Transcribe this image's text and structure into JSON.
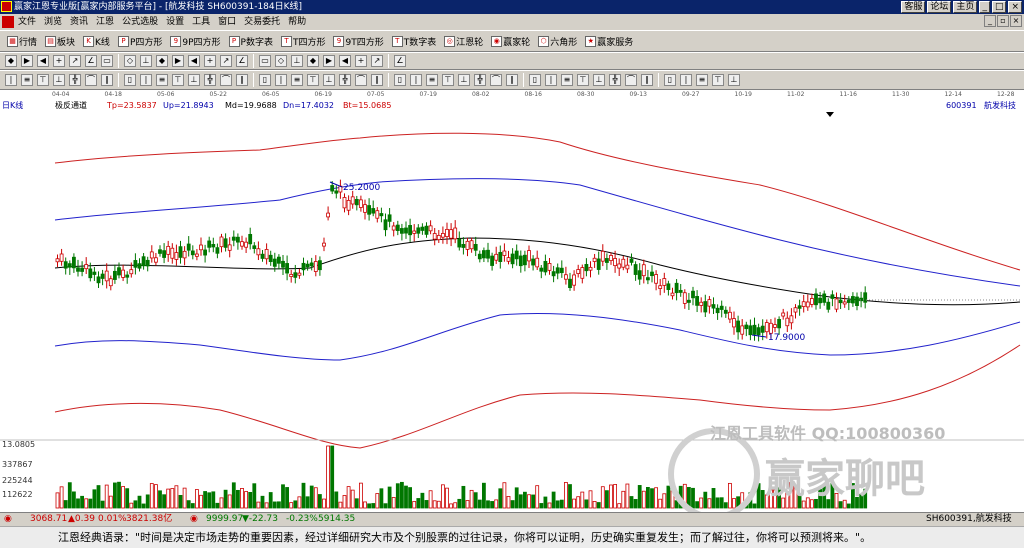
{
  "title": {
    "text": "赢家江恩专业版[赢家内部服务平台] - [航发科技  SH600391-184日K线]",
    "right_buttons": [
      "客服",
      "论坛",
      "主页"
    ]
  },
  "menu": {
    "items": [
      "文件",
      "浏览",
      "资讯",
      "江恩",
      "公式选股",
      "设置",
      "工具",
      "窗口",
      "交易委托",
      "帮助"
    ]
  },
  "toolbar1": {
    "items": [
      {
        "icon": "grid-icon",
        "label": "行情"
      },
      {
        "icon": "blocks-icon",
        "label": "板块"
      },
      {
        "icon": "kline-icon",
        "label": "K线"
      },
      {
        "icon": "p-icon",
        "label": "P四方形"
      },
      {
        "icon": "9p-icon",
        "label": "9P四方形"
      },
      {
        "icon": "pn-icon",
        "label": "P数字表"
      },
      {
        "icon": "t-icon",
        "label": "T四方形"
      },
      {
        "icon": "9t-icon",
        "label": "9T四方形"
      },
      {
        "icon": "tn-icon",
        "label": "T数字表"
      },
      {
        "icon": "wheel-icon",
        "label": "江恩轮"
      },
      {
        "icon": "winwheel-icon",
        "label": "赢家轮"
      },
      {
        "icon": "hexagon-icon",
        "label": "六角形"
      },
      {
        "icon": "service-icon",
        "label": "赢家服务"
      }
    ]
  },
  "infobar": {
    "period": "日K线",
    "indicator": "极反通道",
    "tp": "Tp=23.5837",
    "up": "Up=21.8943",
    "md": "Md=19.9688",
    "dn": "Dn=17.4032",
    "bt": "Bt=15.0685",
    "code": "600391",
    "name": "航发科技"
  },
  "dates": [
    "04-04",
    "04-18",
    "05-06",
    "05-22",
    "06-05",
    "06-19",
    "07-05",
    "07-19",
    "08-02",
    "08-16",
    "08-30",
    "09-13",
    "09-27",
    "10-19",
    "11-02",
    "11-16",
    "11-30",
    "12-14",
    "12-28"
  ],
  "annotations": {
    "high": "25.2000",
    "low": "17.9000"
  },
  "volume_axis": [
    "13.0805",
    "337867",
    "225244",
    "112622"
  ],
  "watermark": {
    "line1": "江恩工具软件  QQ:100800360",
    "line2": "赢家聊吧"
  },
  "statusbar": {
    "sh_index": "3068.71",
    "sh_change": "▲0.39",
    "sh_pct": "0.01%",
    "sh_amount": "3821.38亿",
    "second_index": "9999.97",
    "second_change": "▼-22.73",
    "second_pct": "-0.23%",
    "second_amount": "5914.35",
    "right": "SH600391,航发科技"
  },
  "quote": "江恩经典语录：\"时间是决定市场走势的重要因素，经过详细研究大市及个别股票的过往记录，你将可以证明，历史确实重复发生；而了解过往，你将可以预测将来。\"。",
  "colors": {
    "up": "#cc0000",
    "down": "#007700",
    "outer_band": "#cc2222",
    "inner_band": "#2222cc",
    "mid_line": "#000000"
  }
}
